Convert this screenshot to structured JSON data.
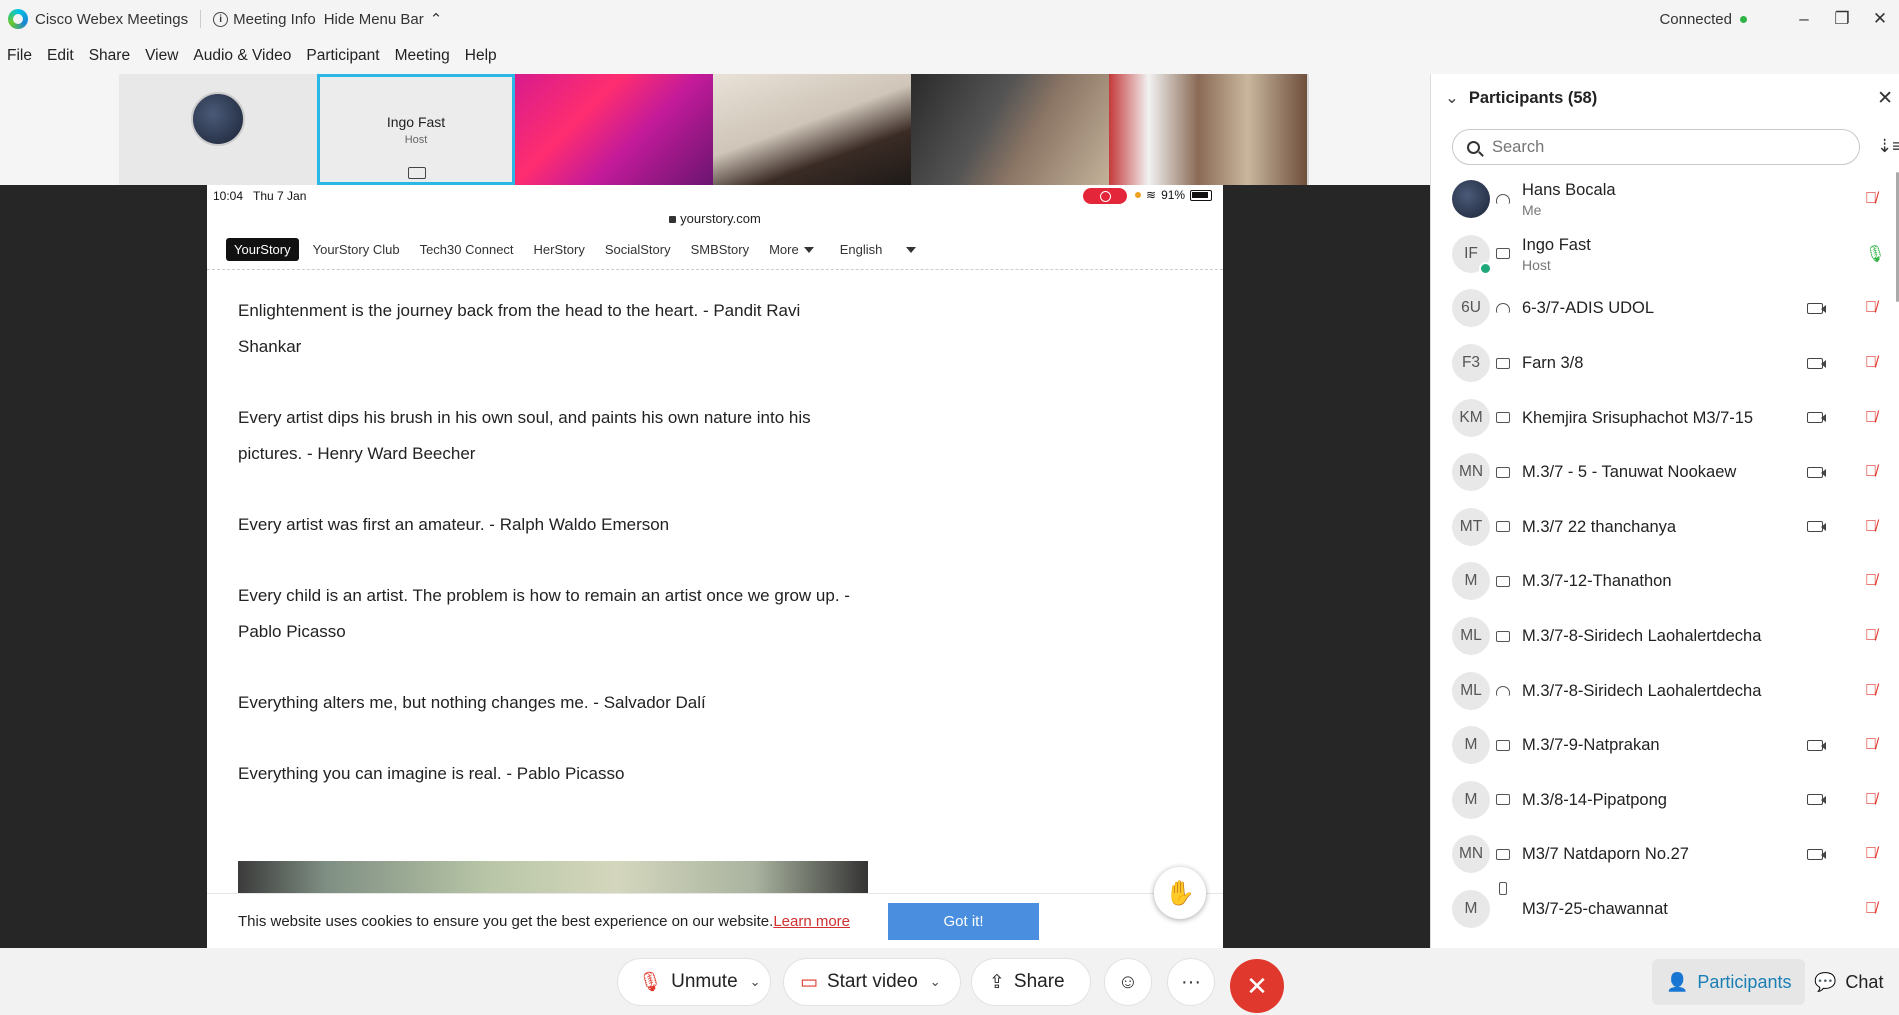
{
  "titlebar": {
    "app": "Cisco Webex Meetings",
    "meeting_info": "Meeting Info",
    "hide_menu": "Hide Menu Bar",
    "status": "Connected"
  },
  "menu": [
    "File",
    "Edit",
    "Share",
    "View",
    "Audio & Video",
    "Participant",
    "Meeting",
    "Help"
  ],
  "strip": {
    "host_name": "Ingo Fast",
    "host_role": "Host"
  },
  "phone": {
    "time": "10:04",
    "date": "Thu 7 Jan",
    "battery": "91%",
    "url": "yourstory.com",
    "nav": {
      "logo": "YourStory",
      "items": [
        "YourStory Club",
        "Tech30 Connect",
        "HerStory",
        "SocialStory",
        "SMBStory"
      ],
      "more": "More",
      "language": "English"
    },
    "quotes": [
      "Enlightenment is the journey back from the head to the heart. - Pandit Ravi Shankar",
      "Every artist dips his brush in his own soul, and paints his own nature into his pictures. - Henry Ward Beecher",
      "Every artist was first an amateur. - Ralph Waldo Emerson",
      "Every child is an artist. The problem is how to remain an artist once we grow up. - Pablo Picasso",
      "Everything alters me, but nothing changes me. - Salvador Dalí",
      "Everything you can imagine is real. - Pablo Picasso"
    ],
    "cookie_text": "This website uses cookies to ensure you get the best experience on our website.",
    "cookie_link": "Learn more",
    "cookie_button": "Got it!"
  },
  "controls": {
    "unmute": "Unmute",
    "start_video": "Start video",
    "share": "Share",
    "participants": "Participants",
    "chat": "Chat"
  },
  "panel": {
    "title": "Participants (58)",
    "search_placeholder": "Search",
    "participants": [
      {
        "initials": "",
        "name": "Hans Bocala",
        "sub": "Me",
        "device": "headset",
        "video": false,
        "mic": "muted"
      },
      {
        "initials": "IF",
        "name": "Ingo Fast",
        "sub": "Host",
        "device": "computer",
        "video": false,
        "mic": "on"
      },
      {
        "initials": "6U",
        "name": "6-3/7-ADIS UDOL",
        "sub": "",
        "device": "headset",
        "video": true,
        "mic": "muted"
      },
      {
        "initials": "F3",
        "name": "Farn 3/8",
        "sub": "",
        "device": "computer",
        "video": true,
        "mic": "muted"
      },
      {
        "initials": "KM",
        "name": "Khemjira Srisuphachot M3/7-15",
        "sub": "",
        "device": "computer",
        "video": true,
        "mic": "muted"
      },
      {
        "initials": "MN",
        "name": "M.3/7 - 5 - Tanuwat Nookaew",
        "sub": "",
        "device": "computer",
        "video": true,
        "mic": "muted"
      },
      {
        "initials": "MT",
        "name": "M.3/7 22 thanchanya",
        "sub": "",
        "device": "computer",
        "video": true,
        "mic": "muted"
      },
      {
        "initials": "M",
        "name": "M.3/7-12-Thanathon",
        "sub": "",
        "device": "computer",
        "video": false,
        "mic": "muted"
      },
      {
        "initials": "ML",
        "name": "M.3/7-8-Siridech Laohalertdecha",
        "sub": "",
        "device": "computer",
        "video": false,
        "mic": "muted"
      },
      {
        "initials": "ML",
        "name": "M.3/7-8-Siridech Laohalertdecha",
        "sub": "",
        "device": "headset",
        "video": false,
        "mic": "muted"
      },
      {
        "initials": "M",
        "name": "M.3/7-9-Natprakan",
        "sub": "",
        "device": "computer",
        "video": true,
        "mic": "muted"
      },
      {
        "initials": "M",
        "name": "M.3/8-14-Pipatpong",
        "sub": "",
        "device": "computer",
        "video": true,
        "mic": "muted"
      },
      {
        "initials": "MN",
        "name": "M3/7 Natdaporn No.27",
        "sub": "",
        "device": "computer",
        "video": true,
        "mic": "muted"
      },
      {
        "initials": "M",
        "name": "M3/7-25-chawannat",
        "sub": "",
        "device": "phone",
        "video": false,
        "mic": "muted"
      }
    ]
  },
  "colors": {
    "accent": "#1a7fb5",
    "end_call": "#e0382d",
    "connected": "#2fb344",
    "host_border": "#2ab7e6"
  }
}
